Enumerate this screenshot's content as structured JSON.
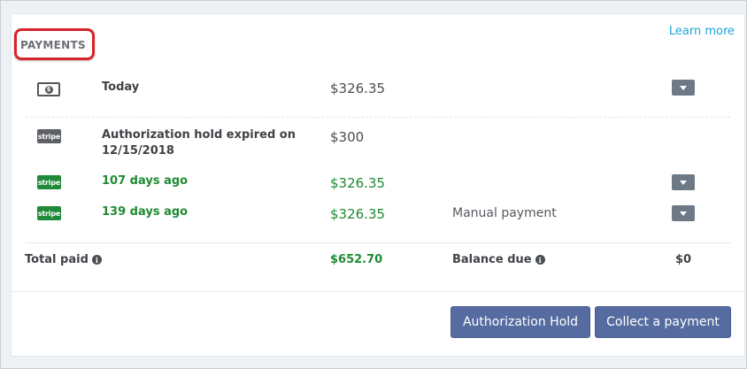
{
  "header": {
    "title": "PAYMENTS",
    "learn_more": "Learn more"
  },
  "payments": [
    {
      "icon": "cash-icon",
      "label": "Today",
      "amount": "$326.35",
      "note": "",
      "status": "normal"
    },
    {
      "icon": "stripe-icon",
      "icon_text": "stripe",
      "label": "Authorization hold expired on 12/15/2018",
      "amount": "$300",
      "note": "",
      "status": "expired"
    },
    {
      "icon": "stripe-icon",
      "icon_text": "stripe",
      "label": "107 days ago",
      "amount": "$326.35",
      "note": "",
      "status": "paid"
    },
    {
      "icon": "stripe-icon",
      "icon_text": "stripe",
      "label": "139 days ago",
      "amount": "$326.35",
      "note": "Manual payment",
      "status": "paid"
    }
  ],
  "totals": {
    "total_paid_label": "Total paid",
    "total_paid_value": "$652.70",
    "balance_due_label": "Balance due",
    "balance_due_value": "$0"
  },
  "actions": {
    "authorization_hold": "Authorization Hold",
    "collect_payment": "Collect a payment"
  },
  "colors": {
    "accent_red": "#d7242a",
    "paid_green": "#1e8a33",
    "button_blue": "#566ca0",
    "link_blue": "#1aa5d8"
  }
}
